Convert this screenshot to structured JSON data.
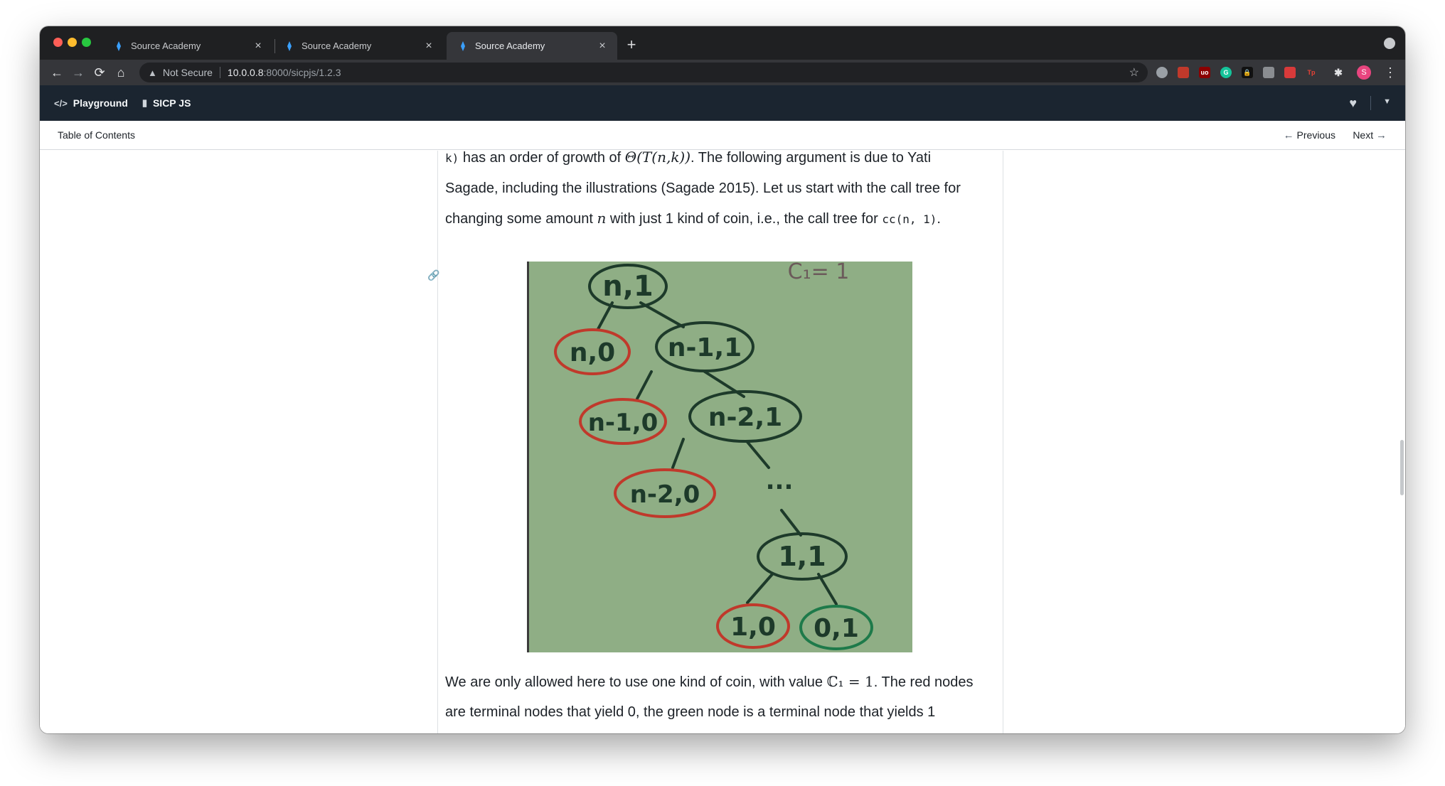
{
  "browser": {
    "tabs": [
      {
        "title": "Source Academy",
        "active": false
      },
      {
        "title": "Source Academy",
        "active": false
      },
      {
        "title": "Source Academy",
        "active": true
      }
    ],
    "new_tab_symbol": "+",
    "address": {
      "security_label": "Not Secure",
      "host": "10.0.0.8",
      "path": ":8000/sicpjs/1.2.3"
    },
    "profile_initial": "S",
    "extension_labels": {
      "ublock": "uo",
      "grammarly": "G",
      "tp": "Tp"
    }
  },
  "app_nav": {
    "playground_label": "Playground",
    "sicp_label": "SICP JS"
  },
  "sub_nav": {
    "toc_label": "Table of Contents",
    "previous_label": "Previous",
    "next_label": "Next"
  },
  "content": {
    "para1": {
      "l1_code": "k)",
      "l1_a": " has an order of growth of ",
      "l1_math": "Θ(T(n,k))",
      "l1_b": ". The following argument is due to Yati",
      "l2": "Sagade, including the illustrations (Sagade 2015). Let us start with the call tree for",
      "l3_a": "changing some amount ",
      "l3_math": "n",
      "l3_b": " with just 1 kind of coin, i.e., the call tree for ",
      "l3_code": "cc(n, 1)",
      "l3_c": "."
    },
    "figure": {
      "label_top": "C₁= 1",
      "nodes": {
        "n1": "n,1",
        "n0": "n,0",
        "nm1_1": "n-1,1",
        "nm1_0": "n-1,0",
        "nm2_1": "n-2,1",
        "nm2_0": "n-2,0",
        "dots": "...",
        "one_one": "1,1",
        "one_zero": "1,0",
        "zero_one": "0,1"
      }
    },
    "para2": {
      "l1_a": "We are only allowed here to use one kind of coin, with value ",
      "l1_math": "ℂ₁ = 1",
      "l1_b": ". The red nodes",
      "l2": "are terminal nodes that yield 0, the green node is a terminal node that yields 1"
    }
  },
  "colors": {
    "tab_strip": "#1f2022",
    "toolbar": "#35363a",
    "app_bar": "#1b2530",
    "figure_bg": "#8eab83",
    "node_dark": "#1d3a2a",
    "node_red": "#c0392b",
    "node_green": "#1e7a4a"
  }
}
